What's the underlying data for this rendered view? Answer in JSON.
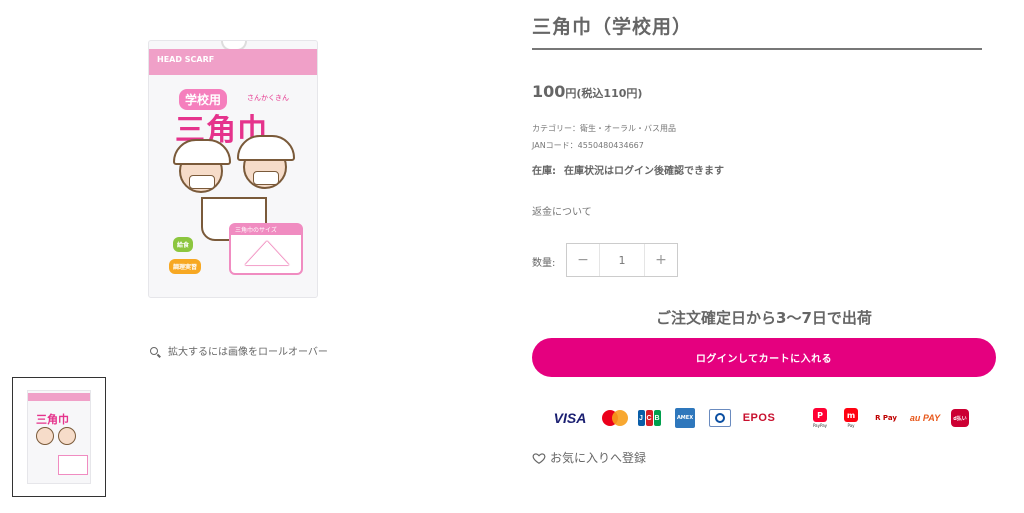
{
  "gallery": {
    "package": {
      "band_text": "HEAD SCARF",
      "badge": "学校用",
      "sub": "さんかくきん",
      "title": "三角巾",
      "size_box_label": "三角巾のサイズ",
      "chip_1": "給食",
      "chip_2": "調理実習"
    },
    "zoom_hint": "拡大するには画像をロールオーバー",
    "thumbnail": {
      "title": "三角巾"
    }
  },
  "product": {
    "title": "三角巾（学校用）",
    "price_value": "100",
    "price_unit": "円",
    "price_tax": "(税込110円)",
    "category": "カテゴリー：衛生・オーラル・バス用品",
    "jan": "JANコード：4550480434667",
    "stock_label": "在庫:",
    "stock_value": "在庫状況はログイン後確認できます",
    "refund_link": "返金について",
    "quantity_label": "数量:",
    "quantity_value": "1",
    "decrement": "−",
    "increment": "+",
    "shipping_note": "ご注文確定日から3〜7日で出荷",
    "add_to_cart": "ログインしてカートに入れる",
    "favorite": "お気に入りへ登録"
  },
  "payments": {
    "visa": "VISA",
    "jcb": [
      "J",
      "C",
      "B"
    ],
    "amex": "AMEX",
    "epos": "EPOS",
    "paypay": "PayPay",
    "merpay": "Pay",
    "rpay": "R Pay",
    "aupay": "au PAY",
    "dbarai": "d払い"
  },
  "colors": {
    "accent": "#e5007f",
    "package_pink": "#e5338c",
    "text": "#666666"
  }
}
